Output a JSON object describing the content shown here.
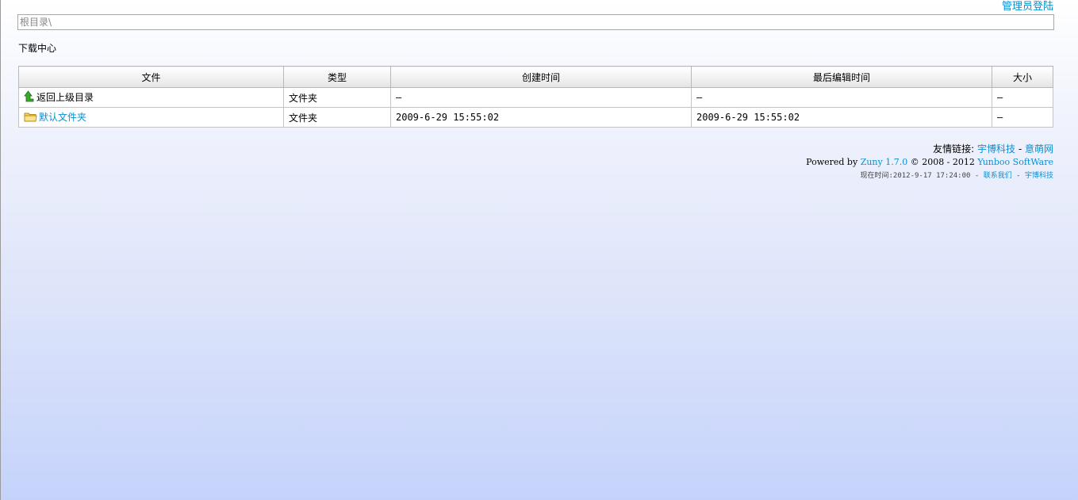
{
  "header": {
    "admin_login": "管理员登陆",
    "path": "根目录\\"
  },
  "page_title": "下载中心",
  "table": {
    "columns": [
      "文件",
      "类型",
      "创建时间",
      "最后编辑时间",
      "大小"
    ],
    "rows": [
      {
        "name": "返回上级目录",
        "type": "文件夹",
        "created": "—",
        "modified": "—",
        "size": "—"
      },
      {
        "name": "默认文件夹",
        "type": "文件夹",
        "created": "2009-6-29 15:55:02",
        "modified": "2009-6-29 15:55:02",
        "size": "—"
      }
    ]
  },
  "footer": {
    "friends_label": "友情链接:",
    "link1": "宇博科技",
    "sep1": " - ",
    "link2": "意萌网",
    "powered_prefix": "Powered by ",
    "zuny": "Zuny 1.7.0",
    "copyright": " © 2008 - 2012 ",
    "yunboo": "Yunboo SoftWare",
    "now_label": "现在时间:2012-9-17 17:24:00",
    "sep2": " - ",
    "contact": "联系我们",
    "sep3": " - ",
    "link3": "宇博科技"
  },
  "icons": {
    "up": "arrow-up-icon",
    "folder": "folder-icon"
  },
  "colors": {
    "link": "#0a8fd0",
    "up_arrow": "#2f9a25",
    "folder": "#f4cc4a"
  }
}
